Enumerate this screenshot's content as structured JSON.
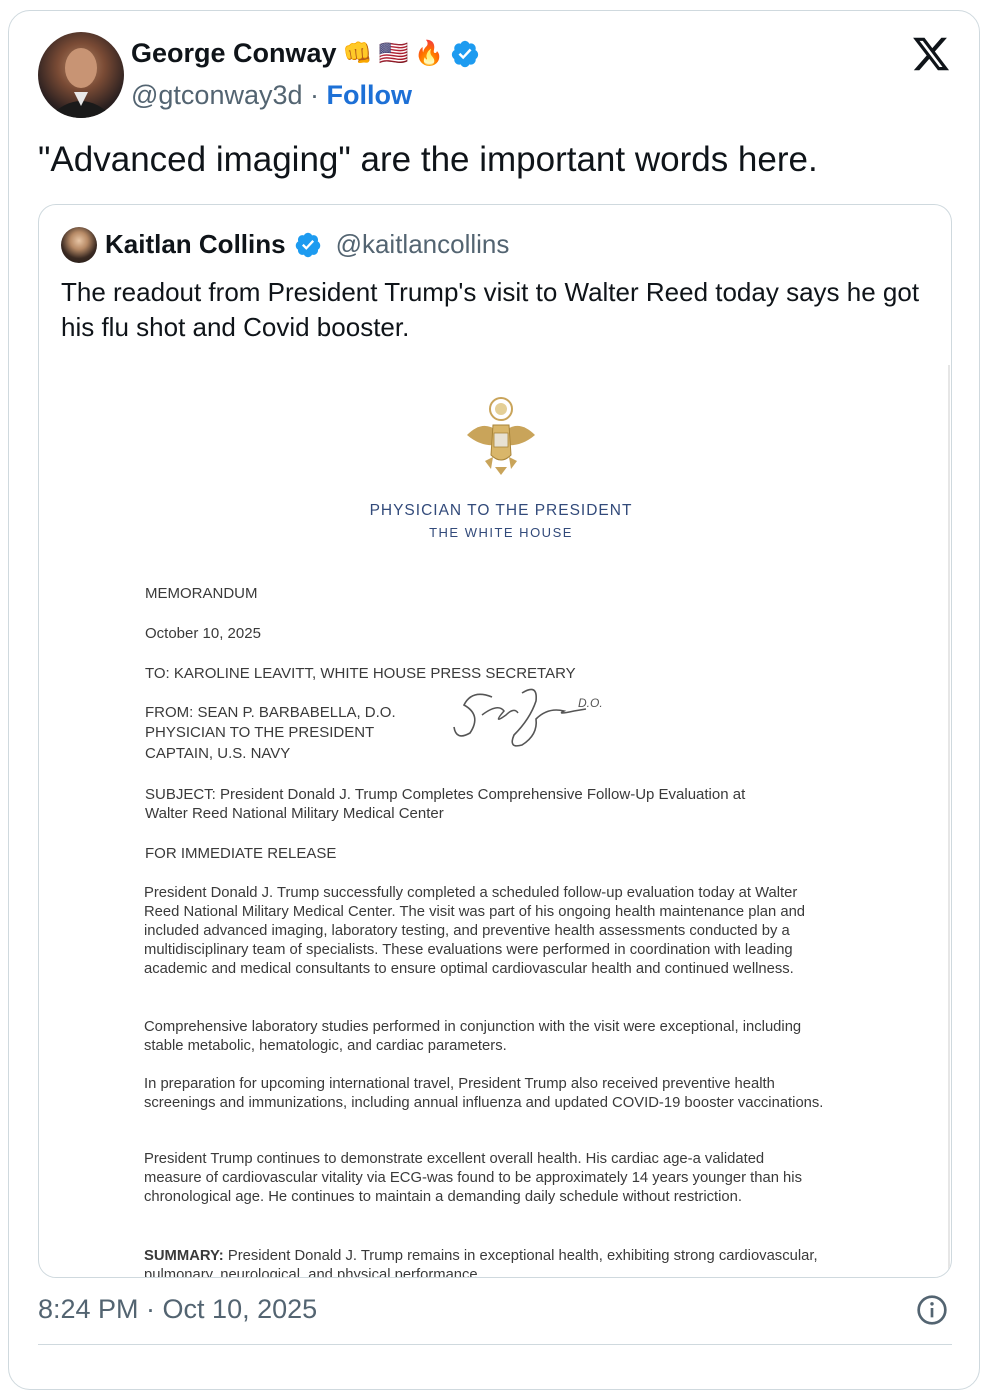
{
  "tweet": {
    "author_name": "George Conway",
    "author_emojis": [
      "👊",
      "🇺🇸",
      "🔥"
    ],
    "handle": "@gtconway3d",
    "separator": "·",
    "follow_label": "Follow",
    "text": "\"Advanced imaging\" are the important words here.",
    "timestamp": "8:24 PM · Oct 10, 2025"
  },
  "quoted_tweet": {
    "author_name": "Kaitlan Collins",
    "handle": "@kaitlancollins",
    "text": "The readout from President Trump's visit to Walter Reed today says he got his flu shot and Covid booster."
  },
  "memo": {
    "office": "PHYSICIAN TO THE PRESIDENT",
    "house": "THE  WHITE  HOUSE",
    "memo_label": "MEMORANDUM",
    "date": "October 10, 2025",
    "to": "TO: KAROLINE LEAVITT, WHITE HOUSE PRESS SECRETARY",
    "from_1": "FROM: SEAN P. BARBABELLA, D.O.",
    "from_2": "PHYSICIAN TO THE PRESIDENT",
    "from_3": "CAPTAIN, U.S. NAVY",
    "signature_suffix": "D.O.",
    "subject_1": "SUBJECT: President Donald J. Trump Completes Comprehensive Follow-Up Evaluation at",
    "subject_2": "Walter Reed National Military Medical Center",
    "release": "FOR IMMEDIATE RELEASE",
    "para1": "President Donald J. Trump successfully completed a scheduled follow-up evaluation today at Walter Reed National Military Medical Center. The visit was part of his ongoing health maintenance plan and included advanced imaging, laboratory testing, and preventive health assessments conducted by a multidisciplinary team of specialists. These evaluations were performed in coordination with leading academic and medical consultants to ensure optimal cardiovascular health and continued wellness.",
    "para2": "Comprehensive laboratory studies performed in conjunction with the visit were exceptional, including stable metabolic, hematologic, and cardiac parameters.",
    "para3": "In preparation for upcoming international travel, President Trump also received preventive health screenings and immunizations, including annual influenza and updated COVID-19 booster vaccinations.",
    "para4": "President Trump continues to demonstrate excellent overall health. His cardiac age-a validated measure of cardiovascular vitality via ECG-was found to be approximately 14 years younger than his chronological age. He continues to maintain a demanding daily schedule without restriction.",
    "summary_label": "SUMMARY:",
    "summary_text": " President Donald J. Trump remains in exceptional health, exhibiting strong cardiovascular, pulmonary, neurological, and physical performance."
  },
  "icons": {
    "verified": "verified-badge-icon",
    "x_logo": "x-logo-icon",
    "info": "info-icon"
  },
  "colors": {
    "verified_blue": "#1d9bf0",
    "follow_blue": "#1d70d6",
    "memo_heading": "#324a7a"
  }
}
